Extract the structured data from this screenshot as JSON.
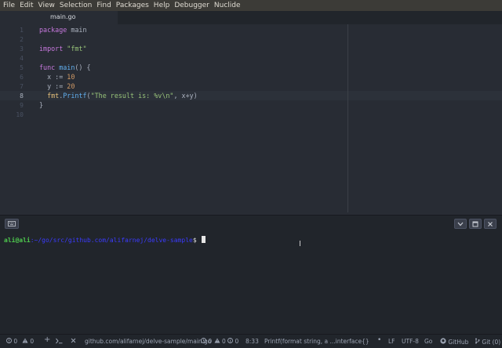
{
  "menu": [
    "File",
    "Edit",
    "View",
    "Selection",
    "Find",
    "Packages",
    "Help",
    "Debugger",
    "Nuclide"
  ],
  "tab": {
    "title": "main.go"
  },
  "editor": {
    "line_numbers": [
      "1",
      "2",
      "3",
      "4",
      "5",
      "6",
      "7",
      "8",
      "9",
      "10"
    ],
    "current_line": "8",
    "lines": {
      "l1_kw": "package",
      "l1_rest": " main",
      "l3_kw": "import",
      "l3_str": " \"fmt\"",
      "l5_kw": "func",
      "l5_fn": " main",
      "l5_rest": "() {",
      "l6_var": "  x := ",
      "l6_num": "10",
      "l7_var": "  y := ",
      "l7_num": "20",
      "l8_pkg": "  fmt",
      "l8_dot": ".",
      "l8_fn": "Printf",
      "l8_open": "(",
      "l8_str": "\"The result is: %v\\n\"",
      "l8_rest": ", x+y)",
      "l9": "}"
    }
  },
  "terminal": {
    "user": "ali@ali",
    "path": ":~/go/src/github.com/alifarnej/delve-sample",
    "dollar": "$ "
  },
  "status": {
    "errors": "0",
    "warnings": "0",
    "file_path": "github.com/alifarnej/delve-sample/main.go",
    "diag_errors": "0",
    "diag_warnings": "0",
    "diag_info": "0",
    "cursor_pos": "8:33",
    "signature": "Printf(format string, a ...interface{}) (n ir",
    "line_ending": "LF",
    "encoding": "UTF-8",
    "grammar": "Go",
    "github": "GitHub",
    "git": "Git (0)"
  },
  "colors": {
    "editor_bg": "#282c34",
    "keyword": "#c678dd",
    "string": "#98c379",
    "number": "#d19a66",
    "function": "#61afef",
    "prompt_user": "#4ec94e",
    "prompt_path": "#3b3bff"
  }
}
